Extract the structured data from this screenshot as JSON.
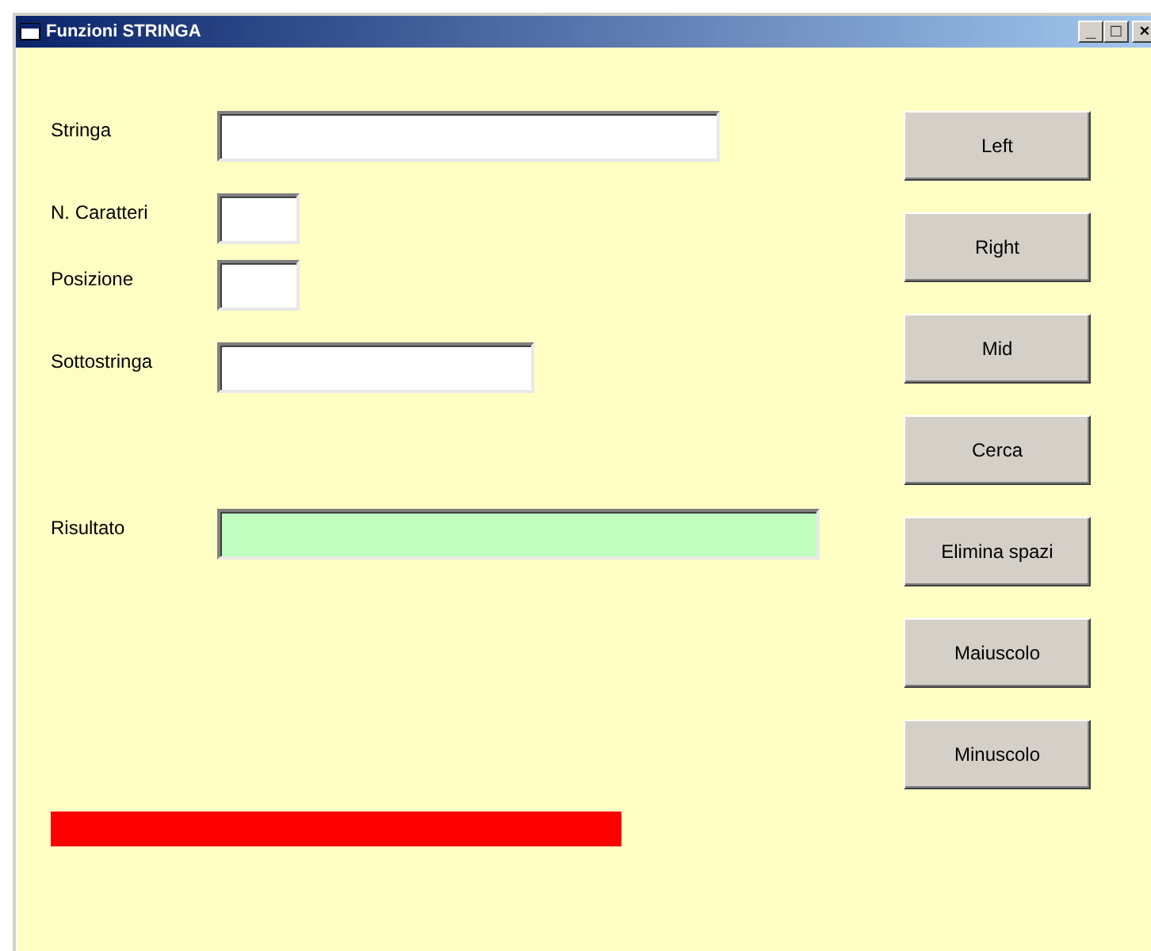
{
  "window": {
    "title": "Funzioni STRINGA",
    "controls": [
      "_",
      "□",
      "×"
    ]
  },
  "fields": [
    {
      "label": "Stringa",
      "kind": "long"
    },
    {
      "label": "N. Caratteri",
      "kind": "short"
    },
    {
      "label": "Posizione",
      "kind": "short"
    },
    {
      "label": "Sottostringa",
      "kind": "medium"
    },
    {
      "label": "Risultato",
      "kind": "result"
    }
  ],
  "buttons": [
    "Left",
    "Right",
    "Mid",
    "Cerca",
    "Elimina spazi",
    "Maiuscolo",
    "Minuscolo"
  ]
}
